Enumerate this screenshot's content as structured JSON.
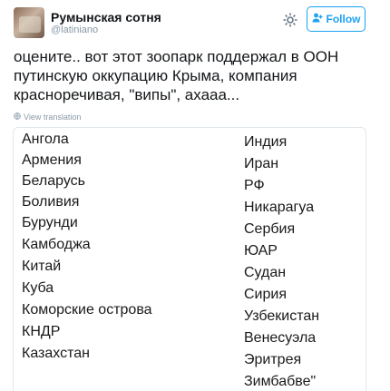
{
  "header": {
    "display_name": "Румынская сотня",
    "handle": "@latiniano",
    "follow_label": "Follow",
    "settings_icon": "gear-icon",
    "follow_icon": "add-user-icon",
    "accent_color": "#1da1f2"
  },
  "tweet": {
    "text_lines": [
      "оцените.. вот этот зоопарк поддержал в ООН",
      "путинскую оккупацию Крыма, компания",
      "красноречивая, \"випы\", ахааа..."
    ],
    "translate_label": "View translation",
    "translate_icon": "globe-icon"
  },
  "image": {
    "left_column": [
      "Ангола",
      "Армения",
      "Беларусь",
      "Боливия",
      "Бурунди",
      "Камбоджа",
      "Китай",
      "Куба",
      "Коморские острова",
      "КНДР",
      "Казахстан"
    ],
    "right_column": [
      "Индия",
      "Иран",
      "РФ",
      "Никарагуа",
      "Сербия",
      "ЮАР",
      "Судан",
      "Сирия",
      "Узбекистан",
      "Венесуэла",
      "Эритрея",
      "Зимбабве\""
    ]
  }
}
